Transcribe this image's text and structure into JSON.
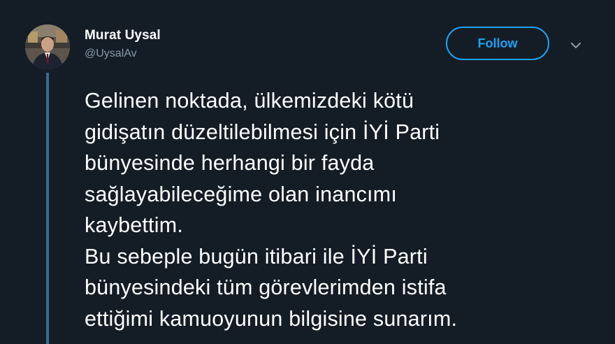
{
  "tweet": {
    "author": {
      "display_name": "Murat Uysal",
      "handle": "@UysalAv"
    },
    "follow_label": "Follow",
    "text": "Gelinen noktada, ülkemizdeki kötü\ngidişatın düzeltilebilmesi için İYİ Parti\nbünyesinde herhangi bir fayda\nsağlayabileceğime olan inancımı\nkaybettim.\nBu sebeple bugün itibari ile İYİ Parti\nbünyesindeki tüm görevlerimden istifa\nettiğimi kamuoyunun bilgisine sunarım."
  },
  "colors": {
    "background": "#141d26",
    "accent": "#1da1f2",
    "secondary_text": "#8899a6",
    "thread_line": "#3b6a90"
  },
  "icons": {
    "more": "chevron-down-icon"
  }
}
